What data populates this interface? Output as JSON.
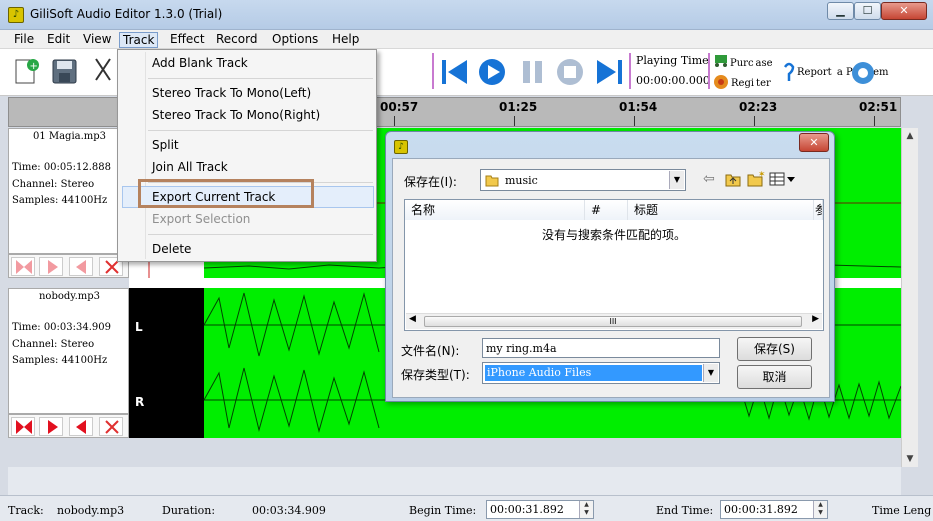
{
  "window": {
    "title": "GiliSoft Audio Editor 1.3.0 (Trial)",
    "min": "▁",
    "max": "☐",
    "close": "✕"
  },
  "menu": {
    "file": "File",
    "edit": "Edit",
    "view": "View",
    "track": "Track",
    "effect": "Effect",
    "record": "Record",
    "options": "Options",
    "help": "Help"
  },
  "toolbar": {
    "playing_time_label": "Playing Time",
    "playing_time_value": "00:00:00.000",
    "purchase": "Purc ase",
    "register": "Regi ter",
    "report": "Report  a Problem"
  },
  "ruler": {
    "ticks": [
      "00:57",
      "01:25",
      "01:54",
      "02:23",
      "02:51"
    ]
  },
  "tracks": [
    {
      "name": "01 Magia.mp3",
      "time": "Time: 00:05:12.888",
      "channel": "Channel: Stereo",
      "samples": "Samples: 44100Hz"
    },
    {
      "name": "nobody.mp3",
      "time": "Time: 00:03:34.909",
      "channel": "Channel: Stereo",
      "samples": "Samples: 44100Hz",
      "left": "L",
      "right": "R"
    }
  ],
  "track_menu": {
    "add_blank": "Add Blank Track",
    "mono_left": "Stereo Track To Mono(Left)",
    "mono_right": "Stereo Track To Mono(Right)",
    "split": "Split",
    "join_all": "Join All Track",
    "export_current": "Export Current Track",
    "export_selection": "Export Selection",
    "delete": "Delete"
  },
  "save_dialog": {
    "save_in_label": "保存在(I):",
    "folder": "music",
    "col_name": "名称",
    "col_num": "#",
    "col_title": "标题",
    "col_more": "参",
    "empty_msg": "没有与搜索条件匹配的项。",
    "filename_label": "文件名(N):",
    "filename_value": "my ring.m4a",
    "filetype_label": "保存类型(T):",
    "filetype_value": "iPhone Audio Files",
    "save_button": "保存(S)",
    "cancel_button": "取消",
    "scroll_thumb": "III"
  },
  "status": {
    "track_label": "Track:",
    "track_value": "nobody.mp3",
    "duration_label": "Duration:",
    "duration_value": "00:03:34.909",
    "begin_label": "Begin Time:",
    "begin_value": "00:00:31.892",
    "end_label": "End Time:",
    "end_value": "00:00:31.892",
    "time_length_label": "Time Leng"
  },
  "colors": {
    "waveform": "#00ee00",
    "accent_blue": "#1673d6",
    "menu_highlight_outline": "#b5825e"
  }
}
